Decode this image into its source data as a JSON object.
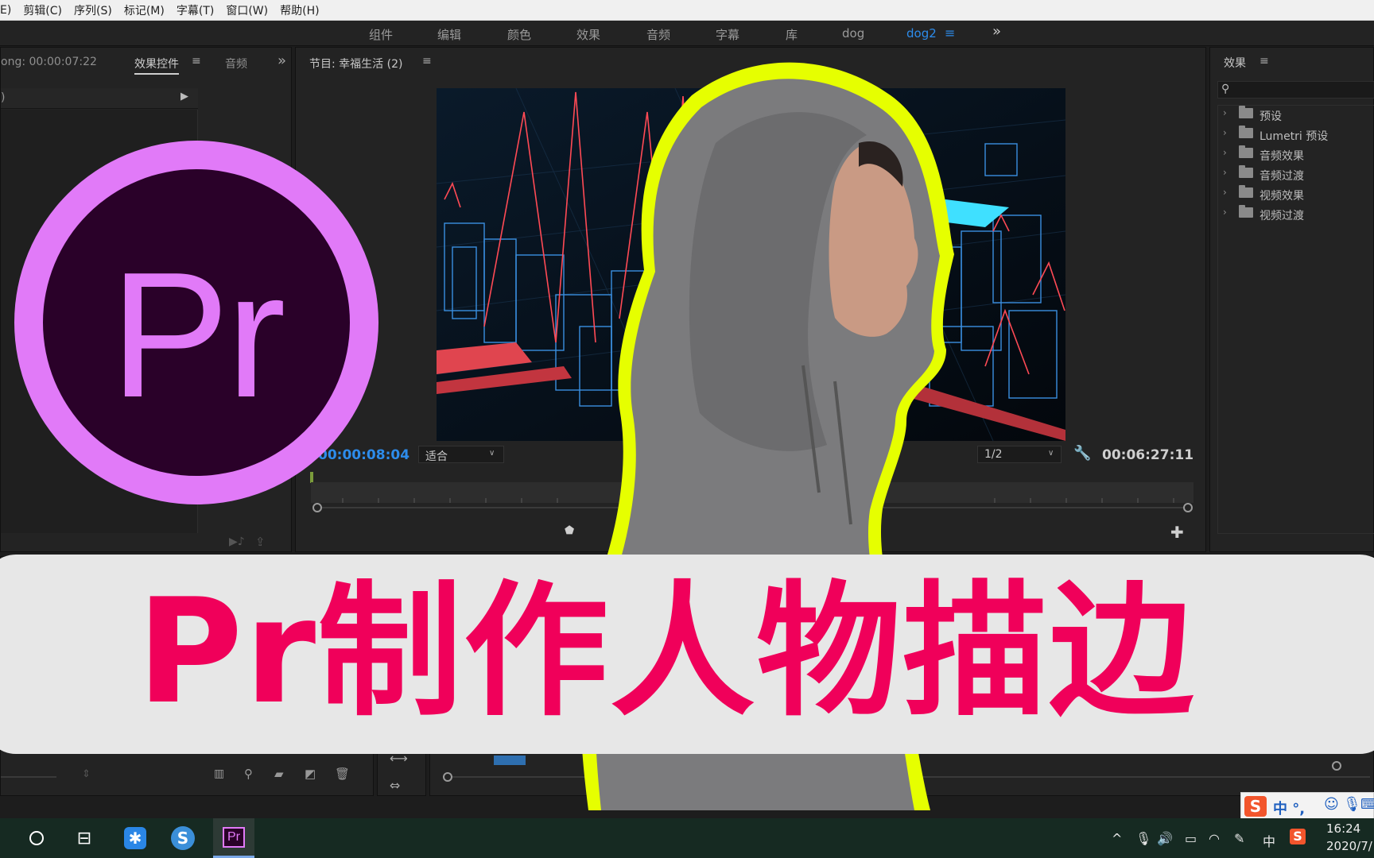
{
  "menubar": {
    "items": [
      "E)",
      "剪辑(C)",
      "序列(S)",
      "标记(M)",
      "字幕(T)",
      "窗口(W)",
      "帮助(H)"
    ]
  },
  "workspace": {
    "tabs": [
      "组件",
      "编辑",
      "颜色",
      "效果",
      "音频",
      "字幕",
      "库",
      "dog",
      "dog2"
    ],
    "active": "dog2",
    "more": "»"
  },
  "left_panel": {
    "source_label": "ong: 00:00:07:22",
    "tab_active": "效果控件",
    "tab_other": "音频",
    "row_label": ")"
  },
  "program": {
    "title": "节目: 幸福生活 (2)",
    "timecode_current": "00:00:08:04",
    "fit": "适合",
    "resolution": "1/2",
    "timecode_duration": "00:06:27:11"
  },
  "effects_panel": {
    "title": "效果",
    "items": [
      "预设",
      "Lumetri 预设",
      "音频效果",
      "音频过渡",
      "视频效果",
      "视频过渡"
    ]
  },
  "logo": {
    "text": "Pr"
  },
  "banner": {
    "text": "Pr制作人物描边"
  },
  "taskbar": {
    "clock_time": "16:24",
    "clock_date": "2020/7/",
    "ime_label": "中",
    "ime_text": "中 °,"
  },
  "colors": {
    "accent": "#2d8ceb",
    "banner_text": "#f0005a",
    "logo": "#e17af8",
    "logo_bg": "#2a0129",
    "outline": "#e6ff00"
  }
}
